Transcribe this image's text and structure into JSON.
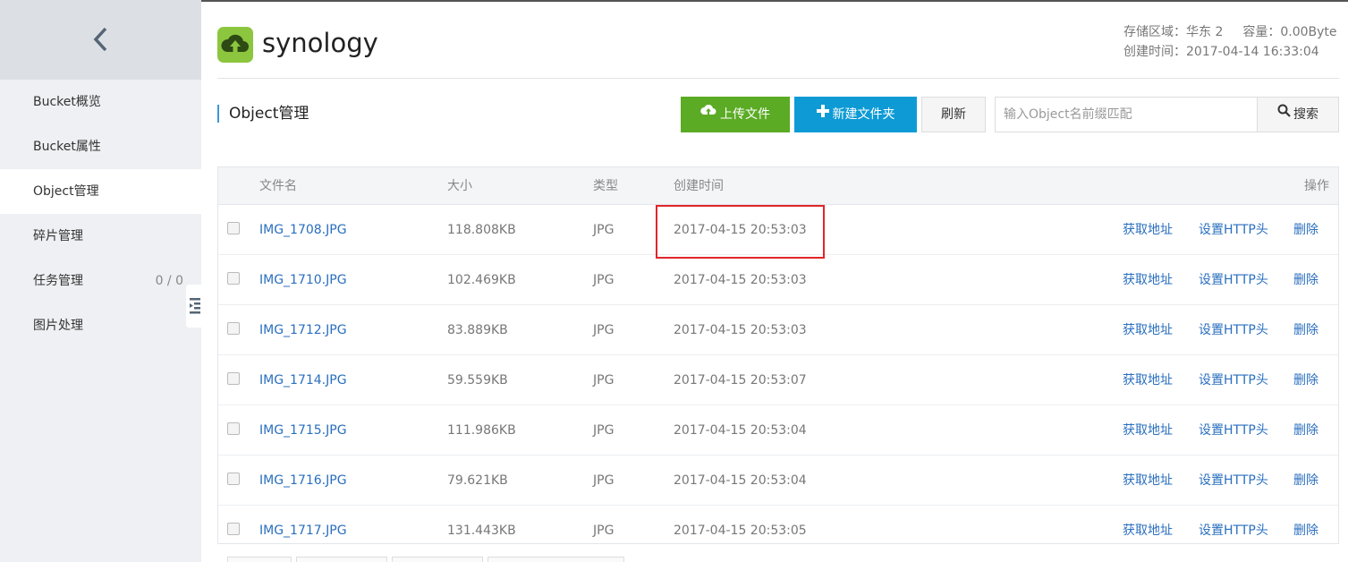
{
  "sidebar": {
    "back_icon": "chevron-left-icon",
    "items": [
      {
        "label": "Bucket概览",
        "active": false
      },
      {
        "label": "Bucket属性",
        "active": false
      },
      {
        "label": "Object管理",
        "active": true
      },
      {
        "label": "碎片管理",
        "active": false
      },
      {
        "label": "任务管理",
        "active": false,
        "count": "0 / 0"
      },
      {
        "label": "图片处理",
        "active": false
      }
    ]
  },
  "header": {
    "bucket_name": "synology",
    "region_text": "存储区域：华东 2",
    "capacity_text": "容量：0.00Byte",
    "created_text": "创建时间：2017-04-14 16:33:04"
  },
  "toolbar": {
    "section_title": "Object管理",
    "upload_label": "上传文件",
    "new_folder_label": "新建文件夹",
    "refresh_label": "刷新",
    "search_placeholder": "输入Object名前缀匹配",
    "search_label": "搜索"
  },
  "table": {
    "columns": {
      "name": "文件名",
      "size": "大小",
      "type": "类型",
      "created": "创建时间",
      "ops": "操作"
    },
    "rows": [
      {
        "name": "IMG_1708.JPG",
        "size": "118.808KB",
        "type": "JPG",
        "created": "2017-04-15 20:53:03",
        "action_url": "获取地址",
        "action_http": "设置HTTP头",
        "action_delete": "删除"
      },
      {
        "name": "IMG_1710.JPG",
        "size": "102.469KB",
        "type": "JPG",
        "created": "2017-04-15 20:53:03",
        "action_url": "获取地址",
        "action_http": "设置HTTP头",
        "action_delete": "删除"
      },
      {
        "name": "IMG_1712.JPG",
        "size": "83.889KB",
        "type": "JPG",
        "created": "2017-04-15 20:53:03",
        "action_url": "获取地址",
        "action_http": "设置HTTP头",
        "action_delete": "删除"
      },
      {
        "name": "IMG_1714.JPG",
        "size": "59.559KB",
        "type": "JPG",
        "created": "2017-04-15 20:53:07",
        "action_url": "获取地址",
        "action_http": "设置HTTP头",
        "action_delete": "删除"
      },
      {
        "name": "IMG_1715.JPG",
        "size": "111.986KB",
        "type": "JPG",
        "created": "2017-04-15 20:53:04",
        "action_url": "获取地址",
        "action_http": "设置HTTP头",
        "action_delete": "删除"
      },
      {
        "name": "IMG_1716.JPG",
        "size": "79.621KB",
        "type": "JPG",
        "created": "2017-04-15 20:53:04",
        "action_url": "获取地址",
        "action_http": "设置HTTP头",
        "action_delete": "删除"
      },
      {
        "name": "IMG_1717.JPG",
        "size": "131.443KB",
        "type": "JPG",
        "created": "2017-04-15 20:53:05",
        "action_url": "获取地址",
        "action_http": "设置HTTP头",
        "action_delete": "删除"
      }
    ]
  },
  "colors": {
    "upload_button": "#5bab24",
    "new_folder_button": "#0e9bd5",
    "link": "#2a6fbf",
    "highlight_box": "#e0262a"
  }
}
